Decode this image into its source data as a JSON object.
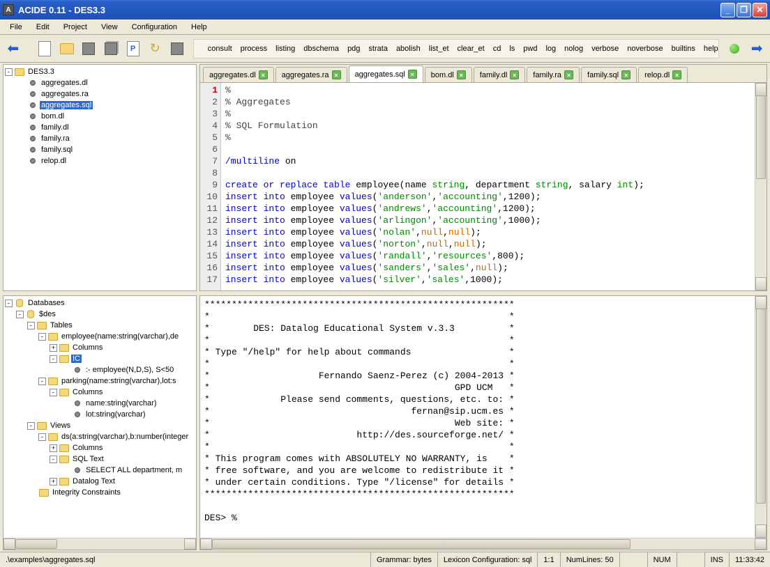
{
  "window": {
    "title": "ACIDE 0.11 - DES3.3",
    "icon_label": "A"
  },
  "menubar": [
    "File",
    "Edit",
    "Project",
    "View",
    "Configuration",
    "Help"
  ],
  "commands": [
    "consult",
    "process",
    "listing",
    "dbschema",
    "pdg",
    "strata",
    "abolish",
    "list_et",
    "clear_et",
    "cd",
    "ls",
    "pwd",
    "log",
    "nolog",
    "verbose",
    "noverbose",
    "builtins",
    "help"
  ],
  "project": {
    "root": "DES3.3",
    "files": [
      "aggregates.dl",
      "aggregates.ra",
      "aggregates.sql",
      "bom.dl",
      "family.dl",
      "family.ra",
      "family.sql",
      "relop.dl"
    ],
    "selected": "aggregates.sql"
  },
  "tabs": [
    {
      "label": "aggregates.dl",
      "active": false
    },
    {
      "label": "aggregates.ra",
      "active": false
    },
    {
      "label": "aggregates.sql",
      "active": true
    },
    {
      "label": "bom.dl",
      "active": false
    },
    {
      "label": "family.dl",
      "active": false
    },
    {
      "label": "family.ra",
      "active": false
    },
    {
      "label": "family.sql",
      "active": false
    },
    {
      "label": "relop.dl",
      "active": false
    }
  ],
  "editor": {
    "lines": 17
  },
  "db_tree": {
    "root": "Databases",
    "db": "$des",
    "tables_label": "Tables",
    "tables": [
      {
        "name": "employee(name:string(varchar),de",
        "columns_label": "Columns",
        "ic_label": "IC",
        "ic_rule": ":- employee(N,D,S), S<50"
      },
      {
        "name": "parking(name:string(varchar),lot:s",
        "columns_label": "Columns",
        "columns": [
          "name:string(varchar)",
          "lot:string(varchar)"
        ]
      }
    ],
    "views_label": "Views",
    "views": [
      {
        "name": "ds(a:string(varchar),b:number(integer",
        "columns_label": "Columns",
        "sql_label": "SQL Text",
        "sql_text": "SELECT ALL department, m",
        "dl_label": "Datalog Text"
      }
    ],
    "ic_label": "Integrity Constraints"
  },
  "console": {
    "lines": [
      "*********************************************************",
      "*                                                       *",
      "*        DES: Datalog Educational System v.3.3          *",
      "*                                                       *",
      "* Type \"/help\" for help about commands                  *",
      "*                                                       *",
      "*                    Fernando Saenz-Perez (c) 2004-2013 *",
      "*                                             GPD UCM   *",
      "*             Please send comments, questions, etc. to: *",
      "*                                     fernan@sip.ucm.es *",
      "*                                             Web site: *",
      "*                           http://des.sourceforge.net/ *",
      "*                                                       *",
      "* This program comes with ABSOLUTELY NO WARRANTY, is    *",
      "* free software, and you are welcome to redistribute it *",
      "* under certain conditions. Type \"/license\" for details *",
      "*********************************************************",
      "",
      "DES> %"
    ]
  },
  "status": {
    "path": ".\\examples\\aggregates.sql",
    "grammar": "Grammar: bytes",
    "lexicon": "Lexicon Configuration: sql",
    "pos": "1:1",
    "numlines": "NumLines: 50",
    "num": "NUM",
    "ins": "INS",
    "time": "11:33:42"
  }
}
